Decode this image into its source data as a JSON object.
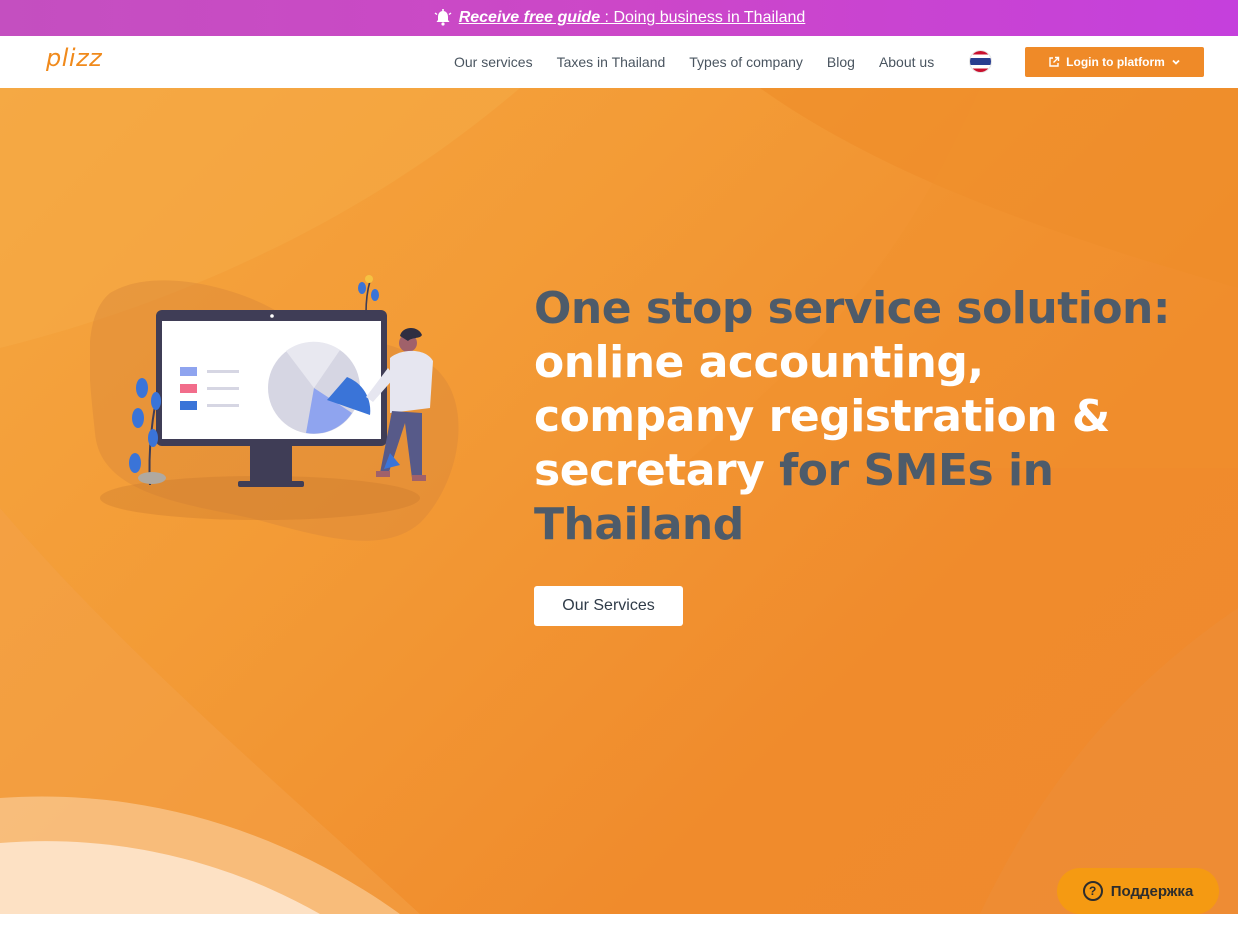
{
  "promo": {
    "strong_text": "Receive free guide",
    "link_text": " : Doing business in Thailand",
    "icon": "bell-icon"
  },
  "nav": {
    "logo": "plizz",
    "links": [
      "Our services",
      "Taxes in Thailand",
      "Types of company",
      "Blog",
      "About us"
    ],
    "language_flag": "thailand-flag-icon",
    "login_label": "Login to platform"
  },
  "hero": {
    "headline_dark_1": "One stop service solution: ",
    "headline_light": "online accounting, company registration & secretary",
    "headline_dark_2": " for SMEs in Thailand",
    "cta_label": "Our Services"
  },
  "support": {
    "label": "Поддержка",
    "icon_glyph": "?"
  },
  "colors": {
    "brand_orange": "#ef8a28",
    "promo_purple": "#c84acb",
    "headline_dark": "#4d5b6a",
    "support_bg": "#f59a12"
  }
}
